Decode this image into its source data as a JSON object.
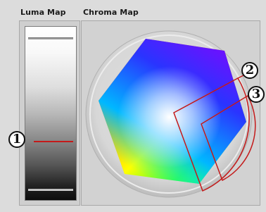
{
  "luma_map": {
    "title": "Luma Map"
  },
  "chroma_map": {
    "title": "Chroma Map"
  },
  "markers": [
    {
      "label": "1",
      "target": "luma-level-line"
    },
    {
      "label": "2",
      "target": "chroma-selection-region"
    },
    {
      "label": "3",
      "target": "chroma-selection-region"
    }
  ],
  "colors": {
    "marker_line": "#c41a1a",
    "panel_bg": "#d2d2d2"
  }
}
